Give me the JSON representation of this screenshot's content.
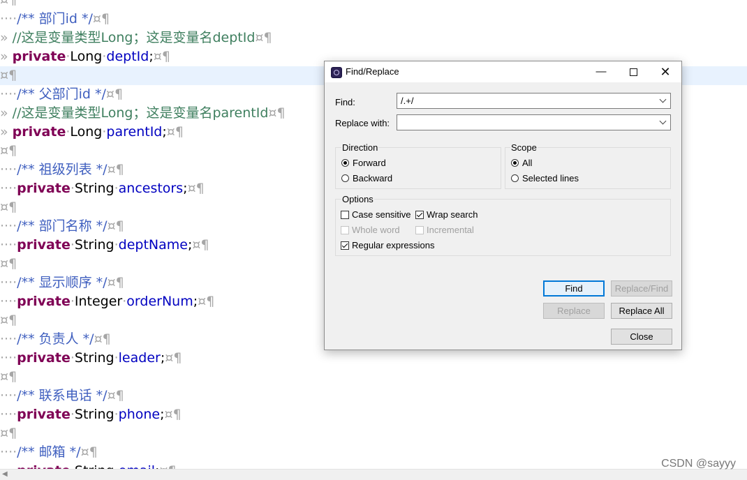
{
  "editor": {
    "lines": [
      {
        "type": "blank",
        "highlight": false
      },
      {
        "type": "doc",
        "indent": "····",
        "text": "/** 部门id */"
      },
      {
        "type": "line_comment",
        "indent": "» ",
        "text": "//这是变量类型Long；这是变量名deptId"
      },
      {
        "type": "field",
        "indent": "» ",
        "keyword": "private",
        "type_name": "Long",
        "field": "deptId"
      },
      {
        "type": "blank",
        "highlight": true
      },
      {
        "type": "doc",
        "indent": "····",
        "text": "/** 父部门id */"
      },
      {
        "type": "line_comment",
        "indent": "» ",
        "text": "//这是变量类型Long；这是变量名parentId"
      },
      {
        "type": "field",
        "indent": "» ",
        "keyword": "private",
        "type_name": "Long",
        "field": "parentId"
      },
      {
        "type": "blank",
        "highlight": false
      },
      {
        "type": "doc",
        "indent": "····",
        "text": "/** 祖级列表 */"
      },
      {
        "type": "field",
        "indent": "····",
        "keyword": "private",
        "type_name": "String",
        "field": "ancestors"
      },
      {
        "type": "blank",
        "highlight": false
      },
      {
        "type": "doc",
        "indent": "····",
        "text": "/** 部门名称 */"
      },
      {
        "type": "field",
        "indent": "····",
        "keyword": "private",
        "type_name": "String",
        "field": "deptName"
      },
      {
        "type": "blank",
        "highlight": false
      },
      {
        "type": "doc",
        "indent": "····",
        "text": "/** 显示顺序 */"
      },
      {
        "type": "field",
        "indent": "····",
        "keyword": "private",
        "type_name": "Integer",
        "field": "orderNum"
      },
      {
        "type": "blank",
        "highlight": false
      },
      {
        "type": "doc",
        "indent": "····",
        "text": "/** 负责人 */"
      },
      {
        "type": "field",
        "indent": "····",
        "keyword": "private",
        "type_name": "String",
        "field": "leader"
      },
      {
        "type": "blank",
        "highlight": false
      },
      {
        "type": "doc",
        "indent": "····",
        "text": "/** 联系电话 */"
      },
      {
        "type": "field",
        "indent": "····",
        "keyword": "private",
        "type_name": "String",
        "field": "phone"
      },
      {
        "type": "blank",
        "highlight": false
      },
      {
        "type": "doc",
        "indent": "····",
        "text": "/** 邮箱 */"
      },
      {
        "type": "field",
        "indent": "····",
        "keyword": "private",
        "type_name": "String",
        "field": "email"
      }
    ],
    "eol_marker": "¤¶",
    "colors": {
      "doc_comment": "#3f5fbf",
      "line_comment": "#3f7f5f",
      "keyword": "#7f0055",
      "field": "#0000c0",
      "highlight": "#e8f2fe"
    }
  },
  "watermark": "CSDN @sayyy",
  "dialog": {
    "title": "Find/Replace",
    "find_label": "Find:",
    "find_value": "/.+/",
    "replace_label": "Replace with:",
    "replace_value": "",
    "direction": {
      "title": "Direction",
      "forward": "Forward",
      "backward": "Backward",
      "selected": "forward"
    },
    "scope": {
      "title": "Scope",
      "all": "All",
      "selected_lines": "Selected lines",
      "selected": "all"
    },
    "options": {
      "title": "Options",
      "case_sensitive": {
        "label": "Case sensitive",
        "checked": false,
        "enabled": true
      },
      "wrap_search": {
        "label": "Wrap search",
        "checked": true,
        "enabled": true
      },
      "whole_word": {
        "label": "Whole word",
        "checked": false,
        "enabled": false
      },
      "incremental": {
        "label": "Incremental",
        "checked": false,
        "enabled": false
      },
      "regular_expressions": {
        "label": "Regular expressions",
        "checked": true,
        "enabled": true
      }
    },
    "buttons": {
      "find": {
        "label": "Find",
        "enabled": true,
        "default": true
      },
      "replace_find": {
        "label": "Replace/Find",
        "enabled": false
      },
      "replace": {
        "label": "Replace",
        "enabled": false
      },
      "replace_all": {
        "label": "Replace All",
        "enabled": true
      },
      "close": {
        "label": "Close",
        "enabled": true
      }
    },
    "accent_color": "#0078d7"
  }
}
